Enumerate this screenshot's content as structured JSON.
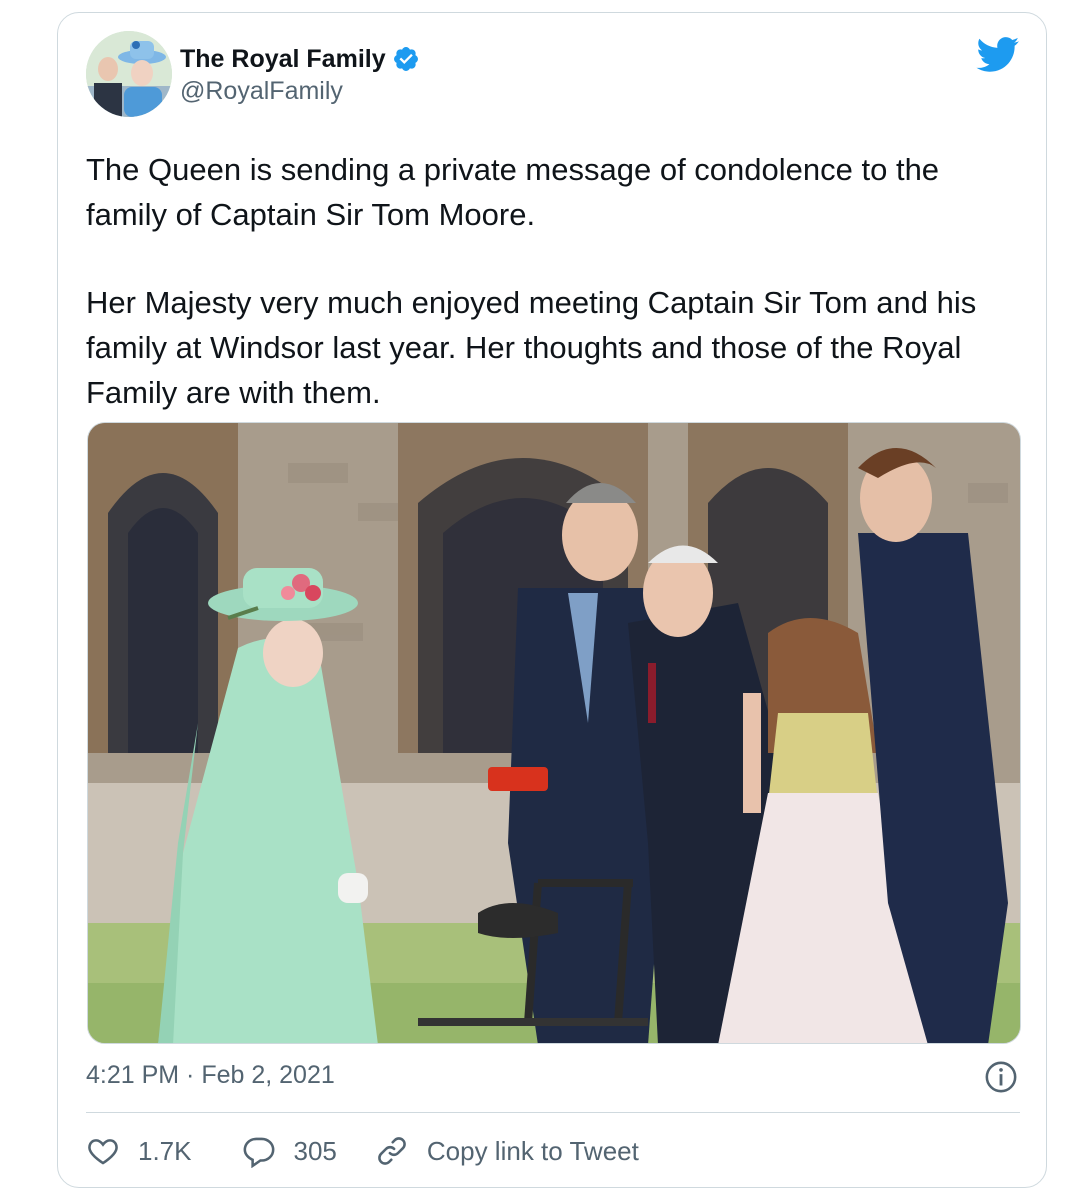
{
  "tweet": {
    "author": {
      "name": "The Royal Family",
      "handle": "@RoyalFamily",
      "verified": true,
      "avatar_icon": "avatar-photo"
    },
    "brand_icon": "twitter-bird-icon",
    "text_paragraphs": [
      "The Queen is sending a private message of condolence to the family of Captain Sir Tom Moore.",
      "Her Majesty very much enjoyed meeting Captain Sir Tom and his family at Windsor last year. Her thoughts and those of the Royal Family are with them."
    ],
    "timestamp": "4:21 PM · Feb 2, 2021",
    "info_icon": "info-icon",
    "actions": {
      "like_count": "1.7K",
      "reply_count": "305",
      "copy_link_label": "Copy link to Tweet"
    }
  },
  "colors": {
    "text_primary": "#0f1419",
    "text_secondary": "#536471",
    "twitter_blue": "#1d9bf0",
    "border": "#cfd9de"
  }
}
